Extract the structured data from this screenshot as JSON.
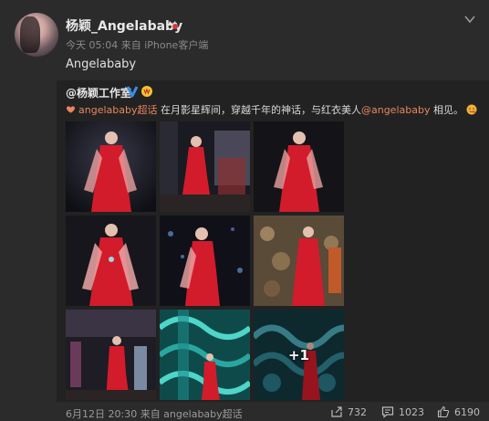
{
  "post": {
    "username": "杨颖_Angelababy",
    "meta": "今天 05:04 来自 iPhone客户端",
    "text": "Angelababy"
  },
  "repost": {
    "user": "@杨颖工作室",
    "supertopic_link": "angelababy超话",
    "text_mid": " 在月影星辉间，穿越千年的神话，与红衣美人",
    "mention": "@angelababy",
    "text_end": " 相见。",
    "more_count": "+1",
    "icons": [
      "verified-v-icon",
      "vip-badge-icon",
      "heart-link-icon",
      "smile-emoji-icon"
    ]
  },
  "images": [
    {
      "name": "photo-1",
      "bg": "dark-stage"
    },
    {
      "name": "photo-2",
      "bg": "stage-wide"
    },
    {
      "name": "photo-3",
      "bg": "dark-stage"
    },
    {
      "name": "photo-4",
      "bg": "dark-stage"
    },
    {
      "name": "photo-5",
      "bg": "lights"
    },
    {
      "name": "photo-6",
      "bg": "bokeh"
    },
    {
      "name": "photo-7",
      "bg": "group"
    },
    {
      "name": "photo-8",
      "bg": "teal-pattern"
    },
    {
      "name": "photo-9",
      "bg": "teal-pattern"
    }
  ],
  "footer": {
    "date": "6月12日 20:30 来自 angelababy超话",
    "reposts": "732",
    "comments": "1023",
    "likes": "6190"
  },
  "colors": {
    "background": "#2b2b2b",
    "repost_background": "#222222",
    "link": "#e9855e",
    "dress_red": "#d21c2b",
    "verified_blue": "#3a8ee6"
  }
}
